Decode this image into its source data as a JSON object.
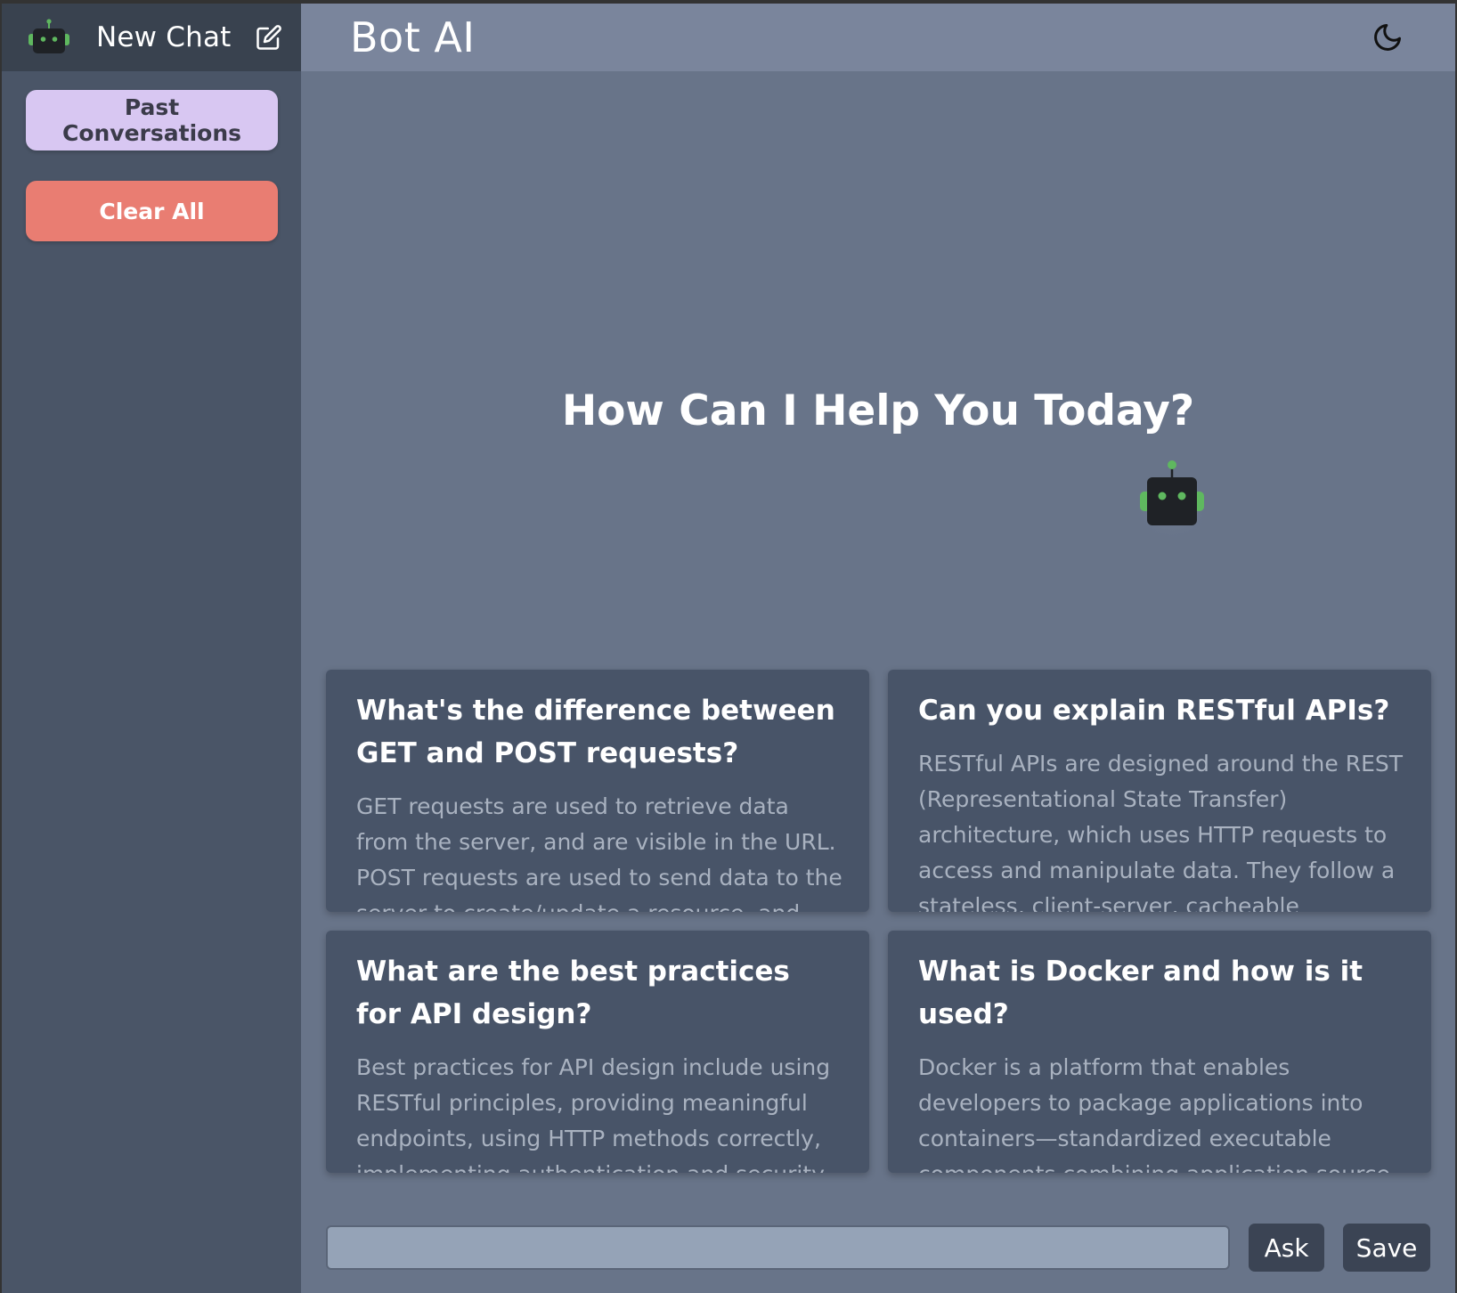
{
  "sidebar": {
    "new_chat_label": "New Chat",
    "past_conversations_label": "Past Conversations",
    "clear_all_label": "Clear All"
  },
  "header": {
    "title": "Bot AI",
    "theme_icon": "moon-icon"
  },
  "welcome": {
    "heading": "How Can I Help You Today?"
  },
  "suggestions": [
    {
      "title": "What's the difference between GET and POST requests?",
      "body": "GET requests are used to retrieve data from the server, and are visible in the URL. POST requests are used to send data to the server to create/update a resource, and the data is included in the body of the request."
    },
    {
      "title": "Can you explain RESTful APIs?",
      "body": "RESTful APIs are designed around the REST (Representational State Transfer) architecture, which uses HTTP requests to access and manipulate data. They follow a stateless, client-server, cacheable communications protocol."
    },
    {
      "title": "What are the best practices for API design?",
      "body": "Best practices for API design include using RESTful principles, providing meaningful endpoints, using HTTP methods correctly, implementing authentication and security, and versioning your API."
    },
    {
      "title": "What is Docker and how is it used?",
      "body": "Docker is a platform that enables developers to package applications into containers—standardized executable components combining application source code with the OS libraries and dependencies."
    }
  ],
  "composer": {
    "input_value": "",
    "input_placeholder": "",
    "ask_label": "Ask",
    "save_label": "Save"
  },
  "colors": {
    "sidebar_bg": "#4a5567",
    "sidebar_header_bg": "#39424f",
    "main_bg": "#687489",
    "topbar_bg": "#7a859c",
    "past_button_bg": "#d8c7f2",
    "clear_button_bg": "#e97d72",
    "card_bg": "#485468",
    "robot_accent": "#5fb85f"
  }
}
